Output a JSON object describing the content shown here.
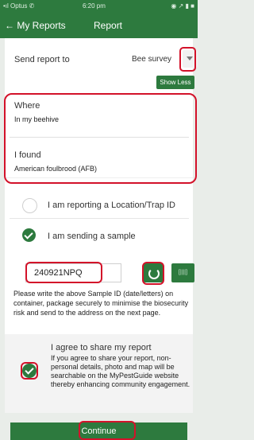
{
  "status_bar": {
    "carrier": "•ıl Optus ✆",
    "time": "6:20 pm",
    "icons": "◉ ↗ ▮ ■"
  },
  "nav": {
    "back_label": "← My Reports",
    "title": "Report"
  },
  "send": {
    "label": "Send report to",
    "value": "Bee survey",
    "show_less": "Show Less"
  },
  "where": {
    "label": "Where",
    "value": "In my beehive"
  },
  "found": {
    "label": "I found",
    "value": "American foulbrood (AFB)"
  },
  "options": {
    "location": "I am reporting a Location/Trap ID",
    "sample": "I am sending a sample"
  },
  "sample_id": {
    "value": "240921NPQ",
    "barcode_label": "[||||]"
  },
  "instructions": "Please write the above Sample ID (date/letters) on container, package securely to minimise the biosecurity risk and send to the address on the next page.",
  "agree": {
    "title": "I agree to share my report",
    "text": "If you agree to share your report, non-personal details, photo and map will be searchable on the MyPestGuide website thereby enhancing community engagement."
  },
  "continue_label": "Continue",
  "colors": {
    "brand_green": "#2d7a3e",
    "highlight_red": "#d3122a"
  }
}
